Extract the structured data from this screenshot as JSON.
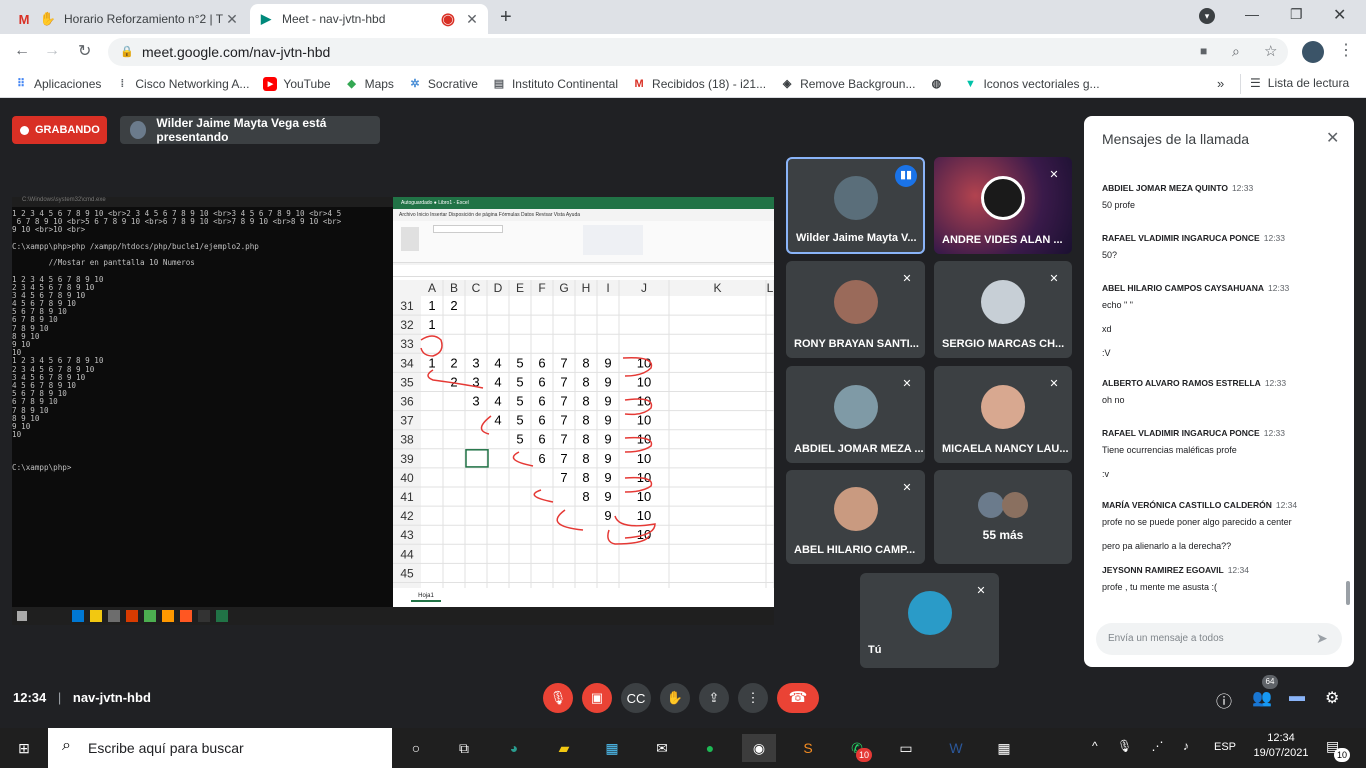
{
  "browser": {
    "tabs": [
      {
        "title": "Horario Reforzamiento n°2 | T",
        "close": "✕"
      },
      {
        "title": "Meet - nav-jvtn-hbd",
        "close": "✕"
      }
    ],
    "new_tab": "+",
    "url": "meet.google.com/nav-jvtn-hbd",
    "bookmarks": [
      "Aplicaciones",
      "Cisco Networking A...",
      "YouTube",
      "Maps",
      "Socrative",
      "Instituto Continental",
      "Recibidos (18) - i21...",
      "Remove Backgroun...",
      "Iconos vectoriales g..."
    ],
    "bookmarks_more": "»",
    "reading_list": "Lista de lectura"
  },
  "meet": {
    "recording": "GRABANDO",
    "presenting": "Wilder Jaime Mayta Vega está presentando",
    "time": "12:34",
    "meeting_code": "nav-jvtn-hbd",
    "participant_count": "64"
  },
  "tiles": [
    {
      "name": "Wilder Jaime Mayta V..."
    },
    {
      "name": "ANDRE VIDES ALAN ..."
    },
    {
      "name": "RONY BRAYAN SANTI..."
    },
    {
      "name": "SERGIO MARCAS CH..."
    },
    {
      "name": "ABDIEL JOMAR MEZA ..."
    },
    {
      "name": "MICAELA NANCY LAU..."
    },
    {
      "name": "ABEL HILARIO CAMP..."
    },
    {
      "name": "55 más"
    },
    {
      "name": "Tú"
    }
  ],
  "chat": {
    "title": "Mensajes de la llamada",
    "messages": [
      {
        "author": "ABDIEL JOMAR MEZA QUINTO",
        "time": "12:33",
        "lines": [
          "50 profe"
        ]
      },
      {
        "author": "RAFAEL VLADIMIR INGARUCA PONCE",
        "time": "12:33",
        "lines": [
          "50?"
        ]
      },
      {
        "author": "ABEL HILARIO CAMPOS CAYSAHUANA",
        "time": "12:33",
        "lines": [
          "echo \"   \"",
          "xd",
          ":V"
        ]
      },
      {
        "author": "ALBERTO ALVARO RAMOS ESTRELLA",
        "time": "12:33",
        "lines": [
          "oh no"
        ]
      },
      {
        "author": "RAFAEL VLADIMIR INGARUCA PONCE",
        "time": "12:33",
        "lines": [
          "Tiene ocurrencias maléficas profe",
          ":v"
        ]
      },
      {
        "author": "MARÍA VERÓNICA CASTILLO CALDERÓN",
        "time": "12:34",
        "lines": [
          "profe no se puede poner algo parecido a center",
          "pero pa alienarlo a la derecha??"
        ]
      },
      {
        "author": "JEYSONN RAMIREZ EGOAVIL",
        "time": "12:34",
        "lines": [
          "profe , tu mente me asusta :("
        ]
      }
    ],
    "input_placeholder": "Envía un mensaje a todos"
  },
  "shared_screen": {
    "cmd_lines": [
      "1 2 3 4 5 6 7 8 9 10 <br>2 3 4 5 6 7 8 9 10 <br>3 4 5 6 7 8 9 10 <br>4 5",
      " 6 7 8 9 10 <br>5 6 7 8 9 10 <br>6 7 8 9 10 <br>7 8 9 10 <br>8 9 10 <br>",
      "9 10 <br>10 <br>",
      "",
      "C:\\xampp\\php>php /xampp/htdocs/php/bucle1/ejemplo2.php",
      "",
      "        //Mostar en panttalla 10 Numeros",
      "",
      "1 2 3 4 5 6 7 8 9 10",
      "2 3 4 5 6 7 8 9 10",
      "3 4 5 6 7 8 9 10",
      "4 5 6 7 8 9 10",
      "5 6 7 8 9 10",
      "6 7 8 9 10",
      "7 8 9 10",
      "8 9 10",
      "9 10",
      "10",
      "1 2 3 4 5 6 7 8 9 10",
      "2 3 4 5 6 7 8 9 10",
      "3 4 5 6 7 8 9 10",
      "4 5 6 7 8 9 10",
      "5 6 7 8 9 10",
      "6 7 8 9 10",
      "7 8 9 10",
      "8 9 10",
      "9 10",
      "10",
      "",
      "",
      "",
      "C:\\xampp\\php>"
    ],
    "excel_columns": [
      "A",
      "B",
      "C",
      "D",
      "E",
      "F",
      "G",
      "H",
      "I",
      "J",
      "K",
      "L"
    ],
    "excel_rows": [
      "31",
      "32",
      "33",
      "34",
      "35",
      "36",
      "37",
      "38",
      "39",
      "40",
      "41",
      "42",
      "43",
      "44",
      "45"
    ],
    "excel_sheet": "Hoja1",
    "excel_cells": [
      [
        "1",
        "2",
        "",
        "",
        "",
        "",
        "",
        "",
        "",
        ""
      ],
      [
        "1",
        "",
        "",
        "",
        "",
        "",
        "",
        "",
        "",
        ""
      ],
      [
        "",
        "",
        "",
        "",
        "",
        "",
        "",
        "",
        "",
        ""
      ],
      [
        "1",
        "2",
        "3",
        "4",
        "5",
        "6",
        "7",
        "8",
        "9",
        "10"
      ],
      [
        "",
        "2",
        "3",
        "4",
        "5",
        "6",
        "7",
        "8",
        "9",
        "10"
      ],
      [
        "",
        "",
        "3",
        "4",
        "5",
        "6",
        "7",
        "8",
        "9",
        "10"
      ],
      [
        "",
        "",
        "",
        "4",
        "5",
        "6",
        "7",
        "8",
        "9",
        "10"
      ],
      [
        "",
        "",
        "",
        "",
        "5",
        "6",
        "7",
        "8",
        "9",
        "10"
      ],
      [
        "",
        "",
        "",
        "",
        "",
        "6",
        "7",
        "8",
        "9",
        "10"
      ],
      [
        "",
        "",
        "",
        "",
        "",
        "",
        "7",
        "8",
        "9",
        "10"
      ],
      [
        "",
        "",
        "",
        "",
        "",
        "",
        "",
        "8",
        "9",
        "10"
      ],
      [
        "",
        "",
        "",
        "",
        "",
        "",
        "",
        "",
        "9",
        "10"
      ],
      [
        "",
        "",
        "",
        "",
        "",
        "",
        "",
        "",
        "",
        "10"
      ],
      [
        "",
        "",
        "",
        "",
        "",
        "",
        "",
        "",
        "",
        ""
      ],
      [
        "",
        "",
        "",
        "",
        "",
        "",
        "",
        "",
        "",
        ""
      ]
    ]
  },
  "taskbar": {
    "search_placeholder": "Escribe aquí para buscar",
    "lang": "ESP",
    "time": "12:34",
    "date": "19/07/2021",
    "notifications": "10",
    "whatsapp_badge": "10"
  }
}
